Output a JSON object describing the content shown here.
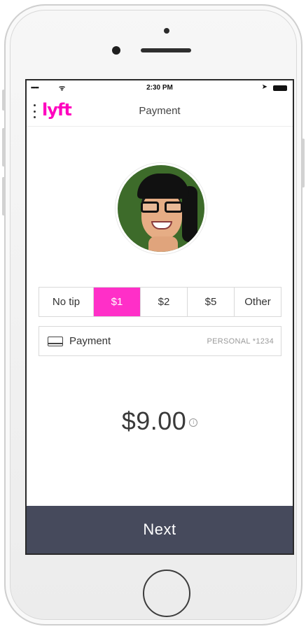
{
  "status_bar": {
    "signal": "•••••",
    "wifi": "ᯤ",
    "time": "2:30 PM",
    "nav_arrow": "➤"
  },
  "header": {
    "logo_text": "lyft",
    "title": "Payment"
  },
  "tip_options": [
    {
      "label": "No tip"
    },
    {
      "label": "$1",
      "selected": true
    },
    {
      "label": "$2"
    },
    {
      "label": "$5"
    },
    {
      "label": "Other"
    }
  ],
  "payment": {
    "label": "Payment",
    "account": "PERSONAL *1234"
  },
  "total": {
    "amount": "$9.00",
    "info_glyph": "i"
  },
  "footer": {
    "next_label": "Next"
  },
  "colors": {
    "brand": "#ff00bf",
    "selected_tip": "#ff2fc8",
    "next_button": "#464a5c"
  },
  "icons": [
    "menu-dots-icon",
    "wifi-icon",
    "location-arrow-icon",
    "battery-icon",
    "card-icon",
    "info-icon"
  ]
}
